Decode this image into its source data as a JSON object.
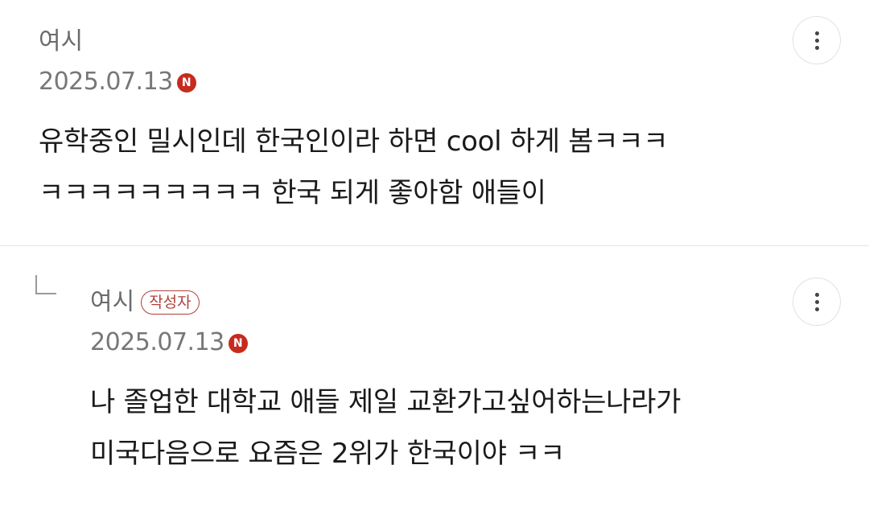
{
  "comments": [
    {
      "author": "여시",
      "date": "2025.07.13",
      "new_badge": "N",
      "body_lines": [
        "유학중인 밀시인데 한국인이라 하면 cool 하게 봄ㅋㅋㅋ",
        "ㅋㅋㅋㅋㅋㅋㅋㅋㅋ 한국 되게 좋아함 애들이"
      ]
    },
    {
      "author": "여시",
      "writer_badge": "작성자",
      "date": "2025.07.13",
      "new_badge": "N",
      "body_lines": [
        "나 졸업한 대학교 애들 제일 교환가고싶어하는나라가",
        "미국다음으로 요즘은 2위가 한국이야 ㅋㅋ"
      ]
    }
  ],
  "icons": {
    "more": "more-vertical-icon",
    "reply": "reply-arrow-icon"
  },
  "colors": {
    "new_badge": "#c62b1e",
    "writer_badge": "#b0413a",
    "divider": "#e6e6e6"
  }
}
